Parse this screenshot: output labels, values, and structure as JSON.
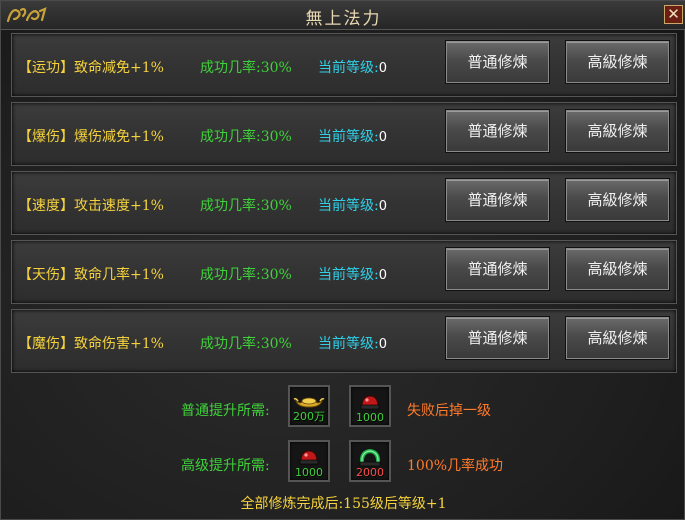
{
  "window": {
    "title": "無上法力",
    "logo_text": "乞乡",
    "close_glyph": "✕"
  },
  "rows": [
    {
      "bracket_open": "【",
      "name": "运功",
      "bracket_close": "】",
      "effect": "致命减免+1%",
      "rate": "成功几率:30%",
      "level_label": "当前等级:",
      "level_value": "0",
      "normal_label": "普通修煉",
      "advanced_label": "高級修煉"
    },
    {
      "bracket_open": "【",
      "name": "爆伤",
      "bracket_close": "】",
      "effect": "爆伤减免+1%",
      "rate": "成功几率:30%",
      "level_label": "当前等级:",
      "level_value": "0",
      "normal_label": "普通修煉",
      "advanced_label": "高級修煉"
    },
    {
      "bracket_open": "【",
      "name": "速度",
      "bracket_close": "】",
      "effect": "攻击速度+1%",
      "rate": "成功几率:30%",
      "level_label": "当前等级:",
      "level_value": "0",
      "normal_label": "普通修煉",
      "advanced_label": "高級修煉"
    },
    {
      "bracket_open": "【",
      "name": "天伤",
      "bracket_close": "】",
      "effect": "致命几率+1%",
      "rate": "成功几率:30%",
      "level_label": "当前等级:",
      "level_value": "0",
      "normal_label": "普通修煉",
      "advanced_label": "高級修煉"
    },
    {
      "bracket_open": "【",
      "name": "魔伤",
      "bracket_close": "】",
      "effect": "致命伤害+1%",
      "rate": "成功几率:30%",
      "level_label": "当前等级:",
      "level_value": "0",
      "normal_label": "普通修煉",
      "advanced_label": "高級修煉"
    }
  ],
  "requirements": {
    "normal": {
      "label": "普通提升所需:",
      "items": [
        {
          "icon": "gold-ingot-icon",
          "qty": "200万"
        },
        {
          "icon": "red-gem-icon",
          "qty": "1000"
        }
      ],
      "note": "失败后掉一级"
    },
    "advanced": {
      "label": "高级提升所需:",
      "items": [
        {
          "icon": "red-gem-icon",
          "qty": "1000"
        },
        {
          "icon": "green-jade-icon",
          "qty": "2000"
        }
      ],
      "note": "100%几率成功"
    }
  },
  "footer": "全部修炼完成后:155级后等级+1",
  "colors": {
    "name": "#f5d23c",
    "rate": "#3fd13a",
    "level": "#2fd0e8",
    "note": "#ff7a2a",
    "qty_red": "#ff4a4a"
  }
}
